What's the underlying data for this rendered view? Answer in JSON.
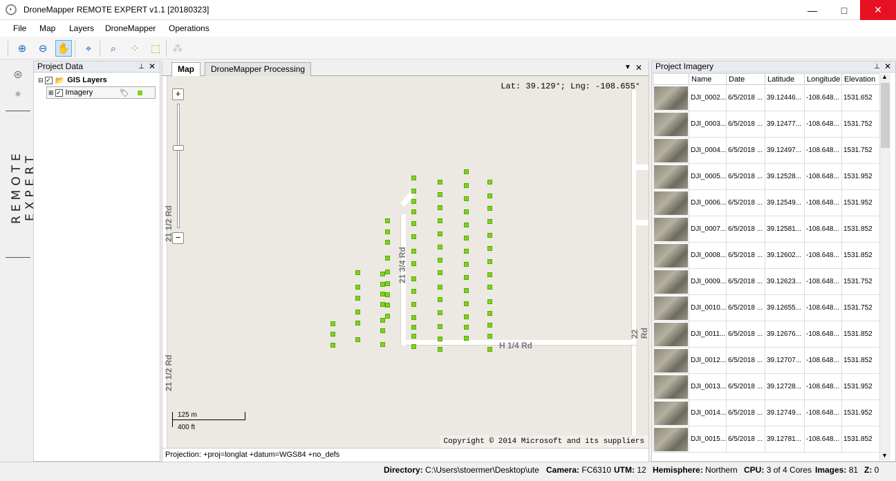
{
  "window": {
    "title": "DroneMapper REMOTE EXPERT v1.1 [20180323]",
    "minimize": "—",
    "maximize": "□",
    "close": "✕"
  },
  "menu": [
    "File",
    "Map",
    "Layers",
    "DroneMapper",
    "Operations"
  ],
  "toolbar": {
    "icons": [
      "zoom-in-icon",
      "zoom-out-icon",
      "pan-icon",
      "locate-icon",
      "zoom-layer-icon",
      "select-points-icon",
      "select-area-icon",
      "disabled-tool-icon"
    ]
  },
  "side_brand": "REMOTE EXPERT",
  "project_data": {
    "title": "Project Data",
    "pin": "📌",
    "close": "✕",
    "root": "GIS Layers",
    "layer": "Imagery"
  },
  "map": {
    "tabs": [
      "Map",
      "DroneMapper Processing"
    ],
    "coords": "Lat: 39.129°; Lng: -108.655°",
    "roads": [
      "21 1/2 Rd",
      "21 3/4 Rd",
      "22 Rd",
      "H 1/4 Rd",
      "21 1/2 Rd"
    ],
    "scale_m": "125 m",
    "scale_ft": "400 ft",
    "copyright": "Copyright © 2014 Microsoft and its suppliers",
    "projection": "Projection: +proj=longlat +datum=WGS84 +no_defs",
    "zoom_in": "+",
    "zoom_out": "−"
  },
  "imagery": {
    "title": "Project Imagery",
    "columns": [
      "",
      "Name",
      "Date",
      "Latitude",
      "Longitude",
      "Elevation"
    ],
    "rows": [
      [
        "DJI_0002...",
        "6/5/2018 ...",
        "39.12446...",
        "-108.648...",
        "1531.652"
      ],
      [
        "DJI_0003...",
        "6/5/2018 ...",
        "39.12477...",
        "-108.648...",
        "1531.752"
      ],
      [
        "DJI_0004...",
        "6/5/2018 ...",
        "39.12497...",
        "-108.648...",
        "1531.752"
      ],
      [
        "DJI_0005...",
        "6/5/2018 ...",
        "39.12528...",
        "-108.648...",
        "1531.952"
      ],
      [
        "DJI_0006...",
        "6/5/2018 ...",
        "39.12549...",
        "-108.648...",
        "1531.952"
      ],
      [
        "DJI_0007...",
        "6/5/2018 ...",
        "39.12581...",
        "-108.648...",
        "1531.852"
      ],
      [
        "DJI_0008...",
        "6/5/2018 ...",
        "39.12602...",
        "-108.648...",
        "1531.852"
      ],
      [
        "DJI_0009...",
        "6/5/2018 ...",
        "39.12623...",
        "-108.648...",
        "1531.752"
      ],
      [
        "DJI_0010...",
        "6/5/2018 ...",
        "39.12655...",
        "-108.648...",
        "1531.752"
      ],
      [
        "DJI_0011...",
        "6/5/2018 ...",
        "39.12676...",
        "-108.648...",
        "1531.852"
      ],
      [
        "DJI_0012...",
        "6/5/2018 ...",
        "39.12707...",
        "-108.648...",
        "1531.852"
      ],
      [
        "DJI_0013...",
        "6/5/2018 ...",
        "39.12728...",
        "-108.648...",
        "1531.952"
      ],
      [
        "DJI_0014...",
        "6/5/2018 ...",
        "39.12749...",
        "-108.648...",
        "1531.952"
      ],
      [
        "DJI_0015...",
        "6/5/2018 ...",
        "39.12781...",
        "-108.648...",
        "1531.852"
      ]
    ]
  },
  "status": {
    "directory_label": "Directory:",
    "directory": "C:\\Users\\stoermer\\Desktop\\ute",
    "camera_label": "Camera:",
    "camera": "FC6310",
    "utm_label": "UTM:",
    "utm": "12",
    "hemisphere_label": "Hemisphere:",
    "hemisphere": "Northern",
    "cpu_label": "CPU:",
    "cpu": "3 of 4 Cores",
    "images_label": "Images:",
    "images": "81",
    "z_label": "Z:",
    "z": "0"
  },
  "colors": {
    "point": "#7ed321",
    "map_bg": "#ece8e2",
    "road": "#ffffff"
  }
}
